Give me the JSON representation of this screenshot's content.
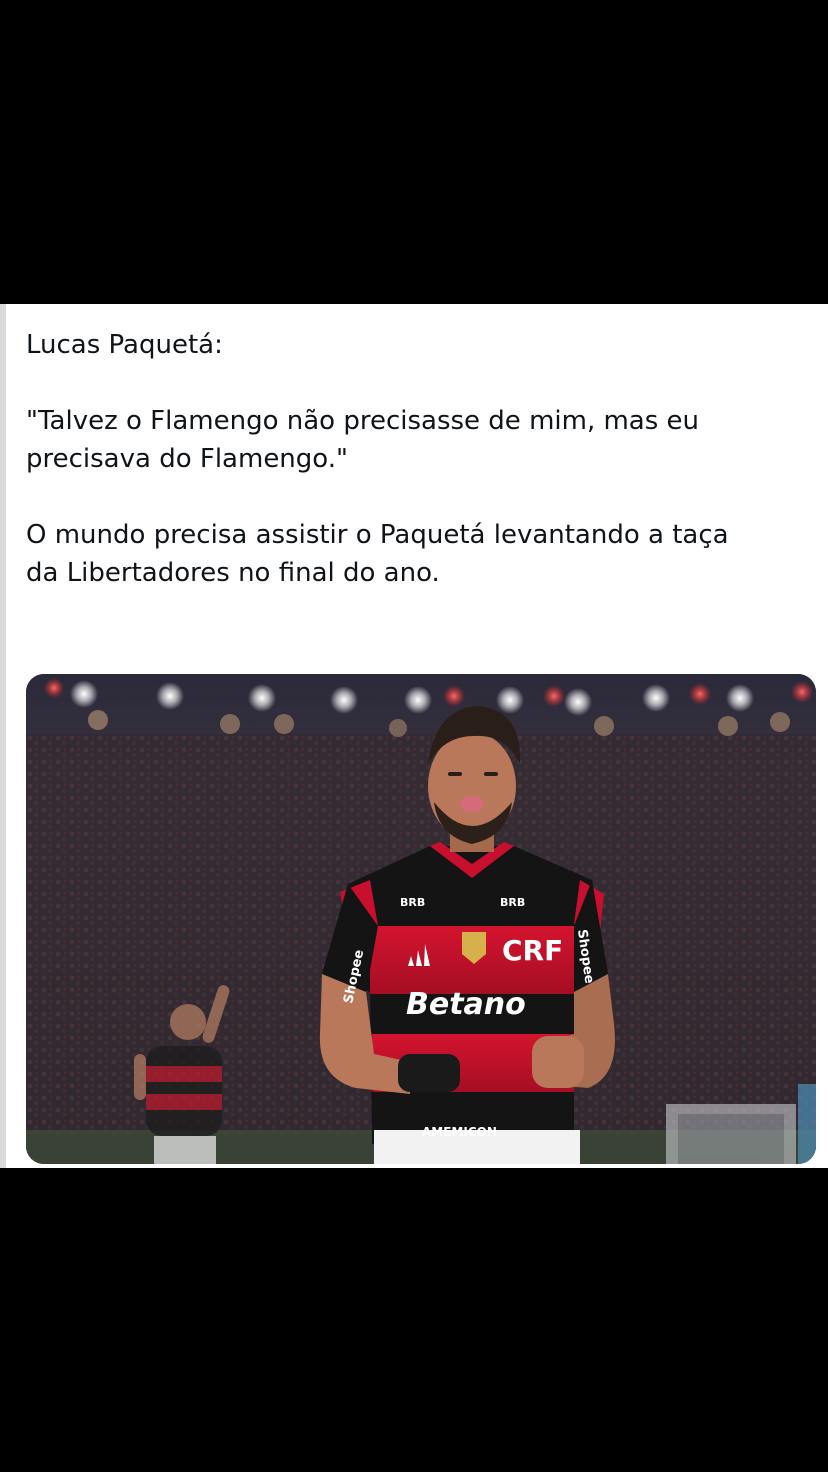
{
  "post": {
    "author_line": "Lucas Paquetá:",
    "quote_line_1": "\"Talvez o Flamengo não precisasse de mim, mas eu",
    "quote_line_2": "precisava do Flamengo.\"",
    "comment_line_1": "O mundo precisa assistir o Paquetá levantando a taça",
    "comment_line_2": "da Libertadores no final do ano."
  },
  "photo": {
    "sponsor_main": "Betano",
    "sponsor_chest_left": "BRB",
    "sponsor_chest_right": "BRB",
    "sleeve_left": "Shopee",
    "sleeve_right": "Shopee",
    "lower_sponsor": "AMEMICON",
    "crest_text": "CRF",
    "colors": {
      "jersey_red": "#c8102e",
      "jersey_black": "#141414",
      "crowd_dark": "#2a2230",
      "skin": "#b9785a"
    }
  },
  "icons": {
    "adidas_logo": "adidas-icon",
    "club_crest": "flamengo-crest-icon",
    "cbf_patch": "champion-patch-icon"
  }
}
